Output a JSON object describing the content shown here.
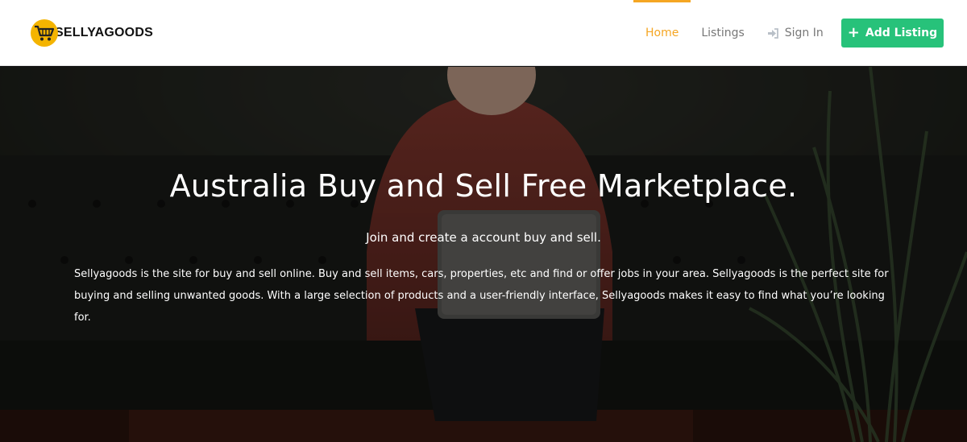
{
  "brand": {
    "name": "SELLYAGOODS",
    "logo_color": "#f4b400"
  },
  "nav": {
    "items": [
      {
        "label": "Home",
        "active": true
      },
      {
        "label": "Listings",
        "active": false
      },
      {
        "label": "Sign In",
        "icon": "sign-in-icon",
        "active": false
      }
    ],
    "active_color": "#f5a623"
  },
  "add_listing": {
    "label": "Add Listing",
    "icon": "plus-icon",
    "color": "#27c27a"
  },
  "hero": {
    "title": "Australia Buy and Sell Free Marketplace.",
    "subtitle": "Join and create a account buy and sell.",
    "description": "Sellyagoods is the site for buy and sell online. Buy and sell items, cars, properties, etc and find or offer jobs in your area. Sellyagoods is the perfect site for buying and selling unwanted goods. With a large selection of products and a user-friendly interface, Sellyagoods makes it easy to find what you’re looking for."
  }
}
